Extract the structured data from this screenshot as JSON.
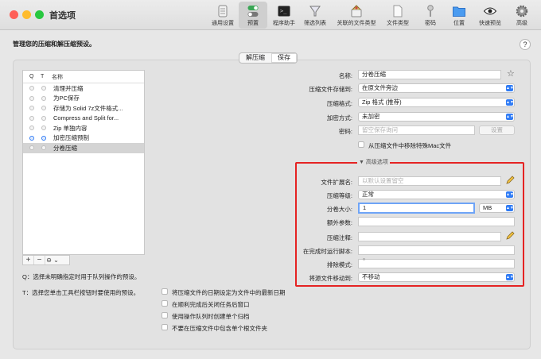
{
  "window": {
    "title": "首选项"
  },
  "toolbar": {
    "items": [
      {
        "label": "通用设置",
        "icon": "phone-settings-icon"
      },
      {
        "label": "预置",
        "icon": "toggle-presets-icon",
        "selected": true
      },
      {
        "label": "程序助手",
        "icon": "terminal-icon"
      },
      {
        "label": "筛选列表",
        "icon": "filter-funnel-icon"
      },
      {
        "label": "关联的文件类型",
        "icon": "archive-box-icon"
      },
      {
        "label": "文件类型",
        "icon": "document-icon"
      },
      {
        "label": "密码",
        "icon": "key-icon"
      },
      {
        "label": "位置",
        "icon": "folder-icon"
      },
      {
        "label": "快速预览",
        "icon": "eye-icon"
      },
      {
        "label": "高级",
        "icon": "gear-icon"
      }
    ]
  },
  "page": {
    "heading": "管理您的压缩和解压缩预设。",
    "help": "?"
  },
  "segmented": {
    "items": [
      "解压缩",
      "保存"
    ],
    "active": 1
  },
  "presets": {
    "col_q": "Q",
    "col_t": "T",
    "col_name": "名称",
    "rows": [
      {
        "name": "清理并压缩",
        "q": false,
        "t": false
      },
      {
        "name": "为PC保存",
        "q": false,
        "t": false
      },
      {
        "name": "存储为 Solid 7z文件格式...",
        "q": false,
        "t": false
      },
      {
        "name": "Compress and Split for...",
        "q": false,
        "t": false
      },
      {
        "name": "Zip 单独内容",
        "q": false,
        "t": false
      },
      {
        "name": "加密压缩预制",
        "q": true,
        "t": true
      },
      {
        "name": "分卷压缩",
        "q": false,
        "t": false,
        "selected": true
      }
    ],
    "add": "+",
    "remove": "−",
    "more": "⊖ ⌄"
  },
  "notes": {
    "q": "Q：选择未明确指定时用于队列操作的预设。",
    "t": "T：选择您单击工具栏按钮时要使用的预设。"
  },
  "form": {
    "name_label": "名称:",
    "name_value": "分卷压缩",
    "save_to_label": "压缩文件存储到:",
    "save_to_value": "在原文件旁边",
    "format_label": "压缩格式:",
    "format_value": "Zip 格式 (推荐)",
    "encrypt_label": "加密方式:",
    "encrypt_value": "未加密",
    "password_label": "密码:",
    "password_placeholder": "留空保存询问",
    "password_button": "设置",
    "strip_mac_label": "从压缩文件中移除特殊Mac文件",
    "advanced_label": "▼ 高级选项",
    "ext_label": "文件扩展名:",
    "ext_placeholder": "以默认设置留空",
    "level_label": "压缩等级:",
    "level_value": "正常",
    "split_label": "分卷大小:",
    "split_value": "1",
    "split_unit": "MB",
    "extra_label": "额外参数:",
    "extra_value": "",
    "comment_label": "压缩注释:",
    "comment_value": "",
    "script_label": "在完成时运行脚本:",
    "script_value": "",
    "exclude_label": "排除模式:",
    "exclude_value": "",
    "move_label": "将源文件移动到:",
    "move_value": "不移动"
  },
  "options": [
    "将压缩文件的日期设定为文件中的最新日期",
    "在顺利完成后关闭任务后窗口",
    "使用操作队列时创建单个归档",
    "不要在压缩文件中包含单个根文件夹"
  ],
  "colors": {
    "accent": "#2f7bf5",
    "highlight_box": "#e52323"
  }
}
